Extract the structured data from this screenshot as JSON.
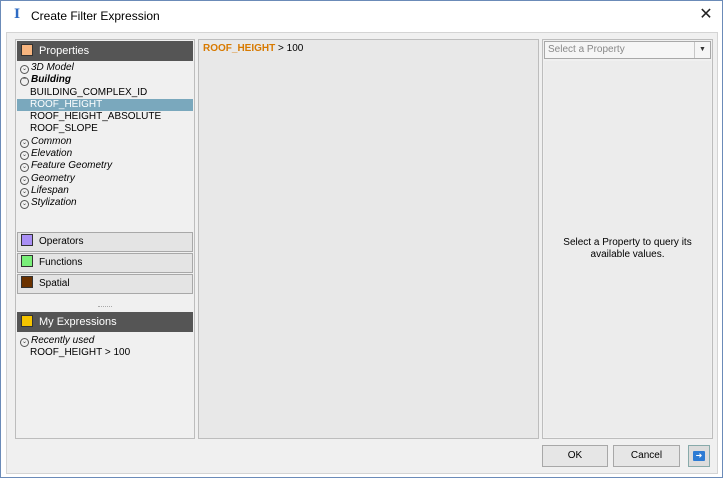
{
  "window": {
    "title": "Create Filter Expression",
    "close_glyph": "✕"
  },
  "properties": {
    "header": "Properties",
    "tree": [
      {
        "label": "3D Model",
        "kind": "category",
        "expanded": false
      },
      {
        "label": "Building",
        "kind": "category",
        "expanded": true
      },
      {
        "label": "BUILDING_COMPLEX_ID",
        "kind": "leaf"
      },
      {
        "label": "ROOF_HEIGHT",
        "kind": "leaf",
        "selected": true
      },
      {
        "label": "ROOF_HEIGHT_ABSOLUTE",
        "kind": "leaf"
      },
      {
        "label": "ROOF_SLOPE",
        "kind": "leaf"
      },
      {
        "label": "Common",
        "kind": "category",
        "expanded": false
      },
      {
        "label": "Elevation",
        "kind": "category",
        "expanded": false
      },
      {
        "label": "Feature Geometry",
        "kind": "category",
        "expanded": false
      },
      {
        "label": "Geometry",
        "kind": "category",
        "expanded": false
      },
      {
        "label": "Lifespan",
        "kind": "category",
        "expanded": false
      },
      {
        "label": "Stylization",
        "kind": "category",
        "expanded": false
      }
    ]
  },
  "tabs": {
    "operators": "Operators",
    "functions": "Functions",
    "spatial": "Spatial"
  },
  "my_expressions": {
    "header": "My Expressions",
    "group": "Recently used",
    "items": [
      "ROOF_HEIGHT > 100"
    ]
  },
  "editor": {
    "property": "ROOF_HEIGHT",
    "rest": " > 100"
  },
  "value_panel": {
    "select_placeholder": "Select a Property",
    "hint": "Select a Property to query its available values."
  },
  "buttons": {
    "ok": "OK",
    "cancel": "Cancel"
  },
  "colors": {
    "properties": "#f7b57f",
    "operators": "#a98ff5",
    "functions": "#79ef79",
    "spatial": "#6b3200",
    "my_expressions": "#f5c400",
    "selected_row": "#7aa8bd",
    "expression_property": "#d87a00"
  },
  "icons": {
    "app": "filter-app-icon",
    "close": "close-icon",
    "expand": "chevron-down-circle-icon",
    "collapse": "chevron-up-circle-icon",
    "dropdown": "caret-down-icon",
    "export": "export-arrow-icon"
  }
}
